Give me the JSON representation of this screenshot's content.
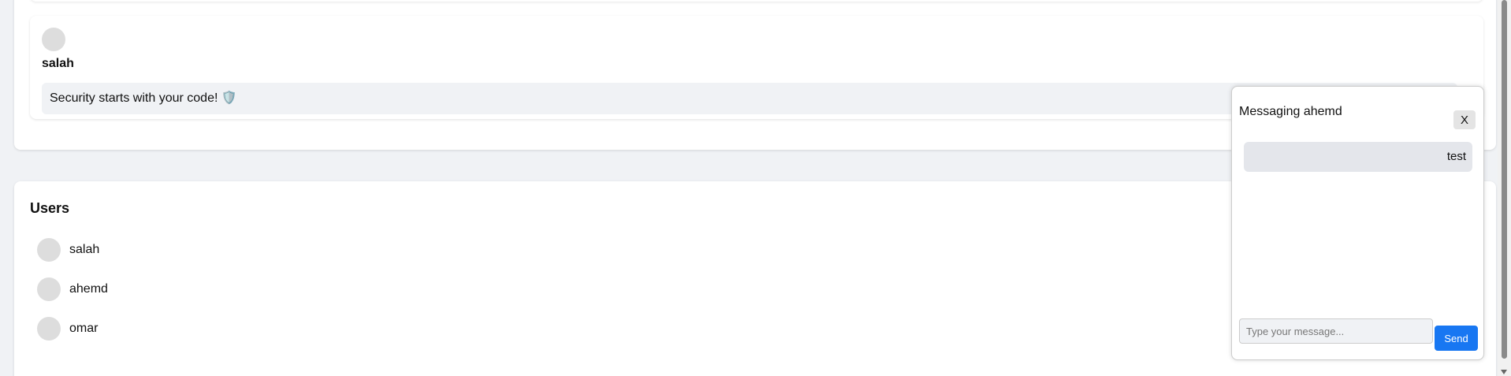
{
  "post": {
    "author": "salah",
    "content": "Security starts with your code! 🛡️"
  },
  "users": {
    "title": "Users",
    "items": [
      {
        "name": "salah"
      },
      {
        "name": "ahemd"
      },
      {
        "name": "omar"
      }
    ]
  },
  "chat": {
    "title": "Messaging ahemd",
    "close_label": "X",
    "messages": [
      {
        "text": "test"
      }
    ],
    "input_placeholder": "Type your message...",
    "input_value": "",
    "send_label": "Send"
  },
  "colors": {
    "background": "#f0f2f5",
    "accent": "#1877f2",
    "avatar": "#dddddd"
  }
}
